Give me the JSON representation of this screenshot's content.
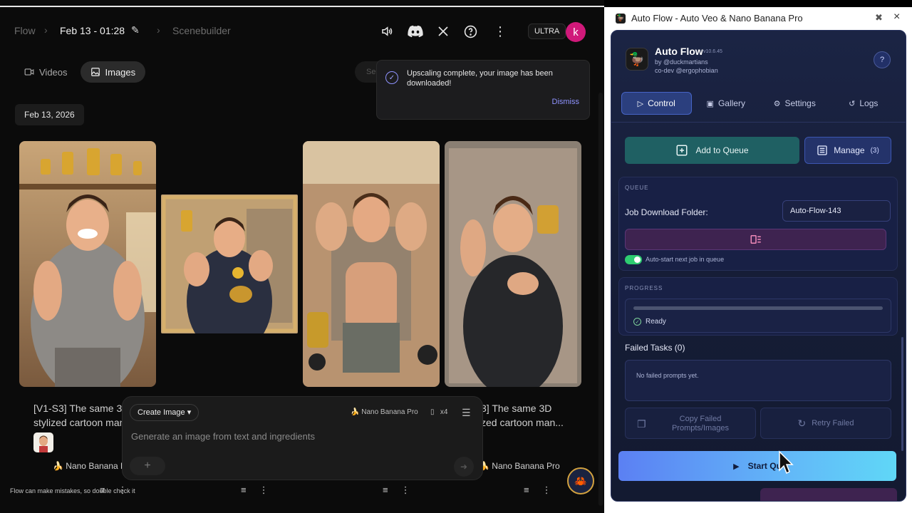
{
  "flow": {
    "breadcrumb": {
      "root": "Flow",
      "project": "Feb 13 - 01:28",
      "section": "Scenebuilder"
    },
    "plan_badge": "ULTRA",
    "avatar_letter": "k",
    "view_tabs": {
      "videos": "Videos",
      "images": "Images"
    },
    "search_placeholder": "Se",
    "toast": {
      "message": "Upscaling complete, your image has been downloaded!",
      "dismiss": "Dismiss"
    },
    "date_chip": "Feb 13, 2026",
    "cards": [
      {
        "caption_line1": "[V1-S3] The same 3D",
        "caption_line2": "stylized cartoon man",
        "model": "Nano Banana F"
      },
      {
        "caption_line1": "3] The same 3D",
        "caption_line2": "zed cartoon man...",
        "model": "Nano Banana Pro"
      }
    ],
    "composer": {
      "mode": "Create Image",
      "model": "Nano Banana Pro",
      "count": "x4",
      "placeholder": "Generate an image from text and ingredients",
      "plus": "+"
    },
    "disclaimer": "Flow can make mistakes, so double check it"
  },
  "extension": {
    "window_title": "Auto Flow - Auto Veo & Nano Banana Pro",
    "app_name": "Auto Flow",
    "version": "v10.6.45",
    "author": "by @duckmartians",
    "codev": "co-dev @ergophobian",
    "help": "?",
    "tabs": {
      "control": "Control",
      "gallery": "Gallery",
      "settings": "Settings",
      "logs": "Logs"
    },
    "add_to_queue": "Add to Queue",
    "manage": "Manage",
    "manage_count": "(3)",
    "queue_label": "QUEUE",
    "job_folder_label": "Job Download Folder:",
    "job_folder_value": "Auto-Flow-143",
    "auto_start_label": "Auto-start next job in queue",
    "progress_label": "PROGRESS",
    "progress_status": "Ready",
    "progress_value": 0,
    "failed_title": "Failed Tasks (0)",
    "failed_empty": "No failed prompts yet.",
    "copy_failed_line1": "Copy Failed",
    "copy_failed_line2": "Prompts/Images",
    "retry_failed": "Retry Failed",
    "start_queue": "Start Qu"
  },
  "colors": {
    "accent": "#8f93ff",
    "avatar": "#d0197a",
    "teal_button": "#1f6063",
    "start_gradient_from": "#5b80f3",
    "start_gradient_to": "#60d7f7",
    "toggle_on": "#2ecc71"
  }
}
